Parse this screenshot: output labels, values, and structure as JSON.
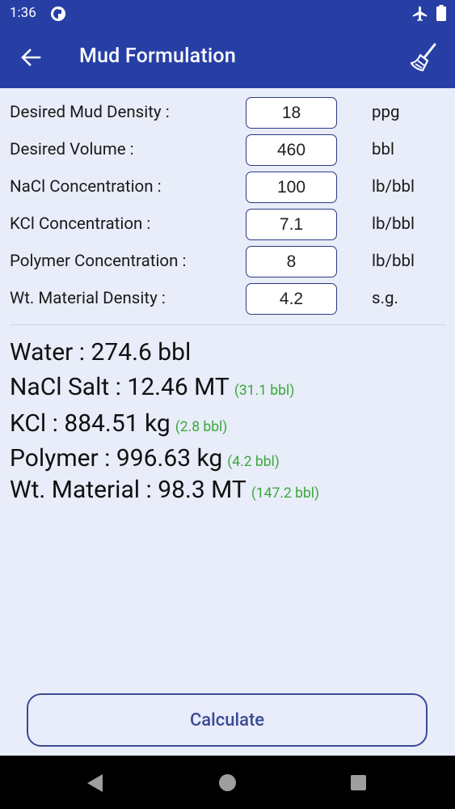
{
  "status_bar": {
    "time": "1:36"
  },
  "app_bar": {
    "title": "Mud Formulation"
  },
  "form": [
    {
      "label": "Desired Mud Density :",
      "value": "18",
      "unit": "ppg"
    },
    {
      "label": "Desired Volume :",
      "value": "460",
      "unit": "bbl"
    },
    {
      "label": "NaCl Concentration :",
      "value": "100",
      "unit": "lb/bbl"
    },
    {
      "label": "KCl Concentration :",
      "value": "7.1",
      "unit": "lb/bbl"
    },
    {
      "label": "Polymer Concentration :",
      "value": "8",
      "unit": "lb/bbl"
    },
    {
      "label": "Wt. Material Density :",
      "value": "4.2",
      "unit": "s.g."
    }
  ],
  "results": [
    {
      "main": "Water : 274.6 bbl",
      "extra": ""
    },
    {
      "main": "NaCl Salt : 12.46 MT",
      "extra": "(31.1 bbl)"
    },
    {
      "main": "KCl : 884.51 kg",
      "extra": "(2.8 bbl)"
    },
    {
      "main": "Polymer : 996.63 kg",
      "extra": "(4.2 bbl)"
    },
    {
      "main": "Wt. Material : 98.3 MT",
      "extra": "(147.2 bbl)"
    }
  ],
  "calculate_label": "Calculate",
  "colors": {
    "primary": "#273fa5",
    "background": "#e8edf9",
    "accent_green": "#3aa83a",
    "button_border": "#3b4a95"
  },
  "icons": [
    "sync-status-icon",
    "airplane-icon",
    "battery-icon",
    "back-arrow-icon",
    "broom-icon",
    "nav-back-icon",
    "nav-home-icon",
    "nav-recents-icon"
  ]
}
